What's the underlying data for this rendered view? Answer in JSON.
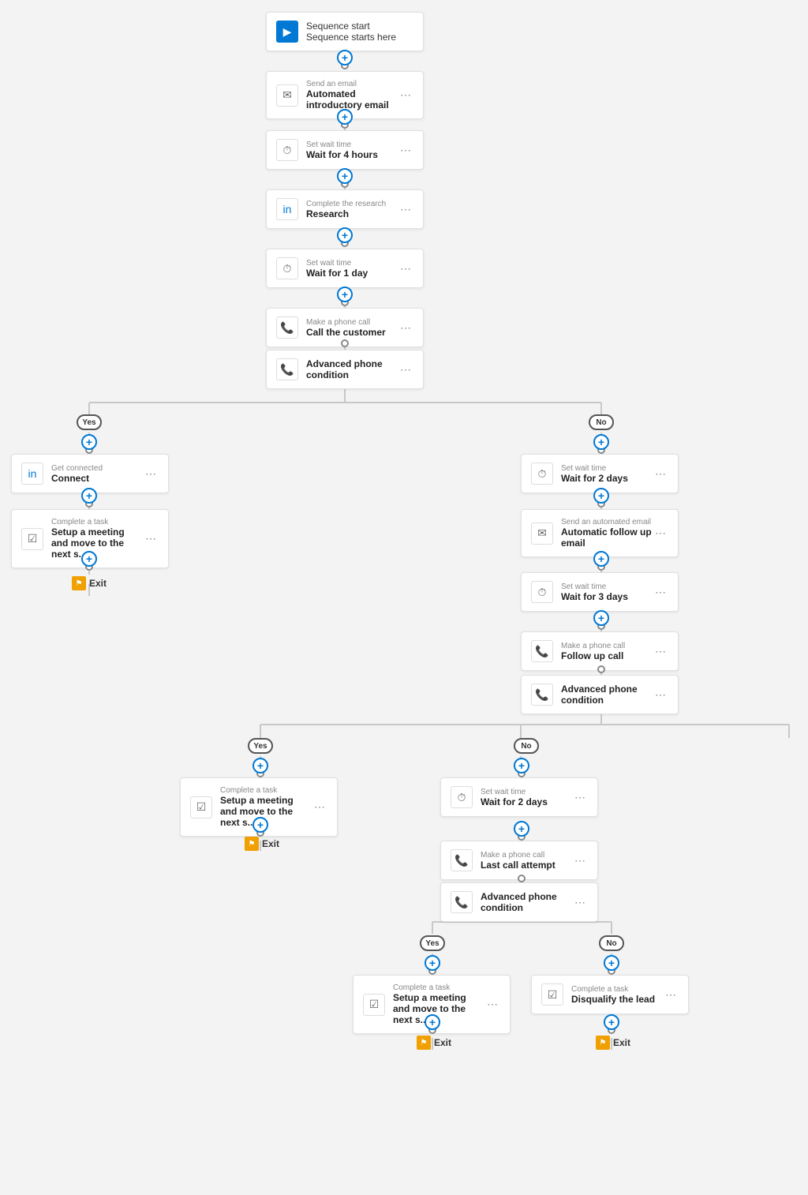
{
  "nodes": {
    "sequence_start": {
      "label": "Sequence start",
      "title": "Sequence starts here"
    },
    "send_email_1": {
      "label": "Send an email",
      "title": "Automated introductory email"
    },
    "wait_4h": {
      "label": "Set wait time",
      "title": "Wait for 4 hours"
    },
    "research": {
      "label": "Complete the research",
      "title": "Research"
    },
    "wait_1d": {
      "label": "Set wait time",
      "title": "Wait for 1 day"
    },
    "call_customer": {
      "label": "Make a phone call",
      "title": "Call the customer"
    },
    "phone_condition_1": {
      "label": "",
      "title": "Advanced phone condition"
    },
    "connect": {
      "label": "Get connected",
      "title": "Connect"
    },
    "setup_meeting_1": {
      "label": "Complete a task",
      "title": "Setup a meeting and move to the next s..."
    },
    "exit_1": {
      "title": "Exit"
    },
    "wait_2d_1": {
      "label": "Set wait time",
      "title": "Wait for 2 days"
    },
    "auto_follow_email": {
      "label": "Send an automated email",
      "title": "Automatic follow up email"
    },
    "wait_3d": {
      "label": "Set wait time",
      "title": "Wait for 3 days"
    },
    "follow_up_call": {
      "label": "Make a phone call",
      "title": "Follow up call"
    },
    "phone_condition_2": {
      "label": "",
      "title": "Advanced phone condition"
    },
    "setup_meeting_2": {
      "label": "Complete a task",
      "title": "Setup a meeting and move to the next s..."
    },
    "exit_2": {
      "title": "Exit"
    },
    "wait_2d_2": {
      "label": "Set wait time",
      "title": "Wait for 2 days"
    },
    "last_call": {
      "label": "Make a phone call",
      "title": "Last call attempt"
    },
    "phone_condition_3": {
      "label": "",
      "title": "Advanced phone condition"
    },
    "setup_meeting_3": {
      "label": "Complete a task",
      "title": "Setup a meeting and move to the next s..."
    },
    "disqualify": {
      "label": "Complete a task",
      "title": "Disqualify the lead"
    },
    "exit_3": {
      "title": "Exit"
    },
    "exit_4": {
      "title": "Exit"
    }
  },
  "badges": {
    "yes": "Yes",
    "no": "No"
  },
  "more_icon": "⋯",
  "plus_icon": "+",
  "exit_icon": "⚑"
}
